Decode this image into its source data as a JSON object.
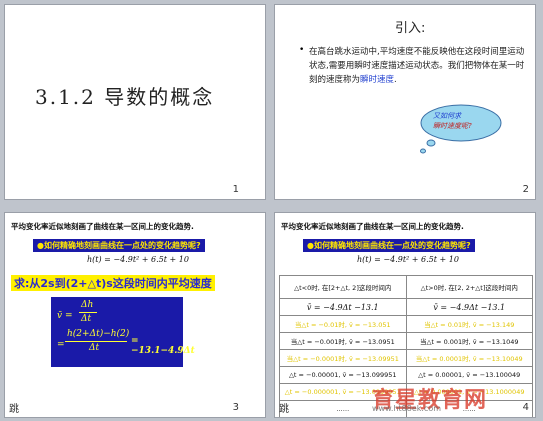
{
  "slides": [
    {
      "number": "1",
      "title": "3.1.2 导数的概念"
    },
    {
      "number": "2",
      "heading": "引入:",
      "text_before": "在高台跳水运动中,平均速度不能反映他在这段时间里运动状态,需要用瞬时速度描述运动状态。我们把物体在某一时刻的速度称为",
      "text_highlight": "瞬时速度",
      "text_after": ".",
      "cloud_line1": "又如何求",
      "cloud_line2": "瞬时速度呢?"
    },
    {
      "number": "3",
      "header": "平均变化率近似地刻画了曲线在某一区间上的变化趋势.",
      "question": "●如何精确地刻画曲线在一点处的变化趋势呢?",
      "equation": "h(t) = −4.9t² + 6.5t + 10",
      "task": "求:从2s到(2+△t)s这段时间内平均速度",
      "formula_lhs": "v̄ =",
      "formula_frac1_num": "Δh",
      "formula_frac1_den": "Δt",
      "formula_frac2_num": "h(2+Δt)−h(2)",
      "formula_frac2_den": "Δt",
      "formula_result": "= −13.1−4.9Δt",
      "corner_label": "跳"
    },
    {
      "number": "4",
      "header": "平均变化率近似地刻画了曲线在某一区间上的变化趋势.",
      "question": "●如何精确地刻画曲线在一点处的变化趋势呢?",
      "equation": "h(t) = −4.9t² + 6.5t + 10",
      "table": {
        "headers": [
          "△t<0时, 在[2+△t, 2]这段时间内",
          "△t>0时, 在[2, 2+△t]这段时间内"
        ],
        "formulas": [
          "v̄ = −4.9Δt −13.1",
          "v̄ = −4.9Δt −13.1"
        ],
        "rows": [
          [
            "当△t = −0.01时, v̄ = −13.051",
            "当△t = 0.01时, v̄ = −13.149"
          ],
          [
            "当△t = −0.001时, v̄ = −13.0951",
            "当△t = 0.001时, v̄ = −13.1049"
          ],
          [
            "当△t = −0.0001时, v̄ = −13.09951",
            "当△t = 0.0001时, v̄ = −13.10049"
          ],
          [
            "△t = −0.00001, v̄ = −13.099951",
            "△t = 0.00001, v̄ = −13.100049"
          ],
          [
            "△t = −0.000001, v̄ = −13.0999951",
            "△t = 0.000001, v̄ = −13.1000049"
          ],
          [
            "……",
            "……"
          ]
        ],
        "highlight_rows": [
          0,
          2,
          4
        ]
      },
      "corner_label": "跳"
    }
  ],
  "watermark": {
    "text": "育星教育网",
    "url": "www.ht88ek.com"
  }
}
